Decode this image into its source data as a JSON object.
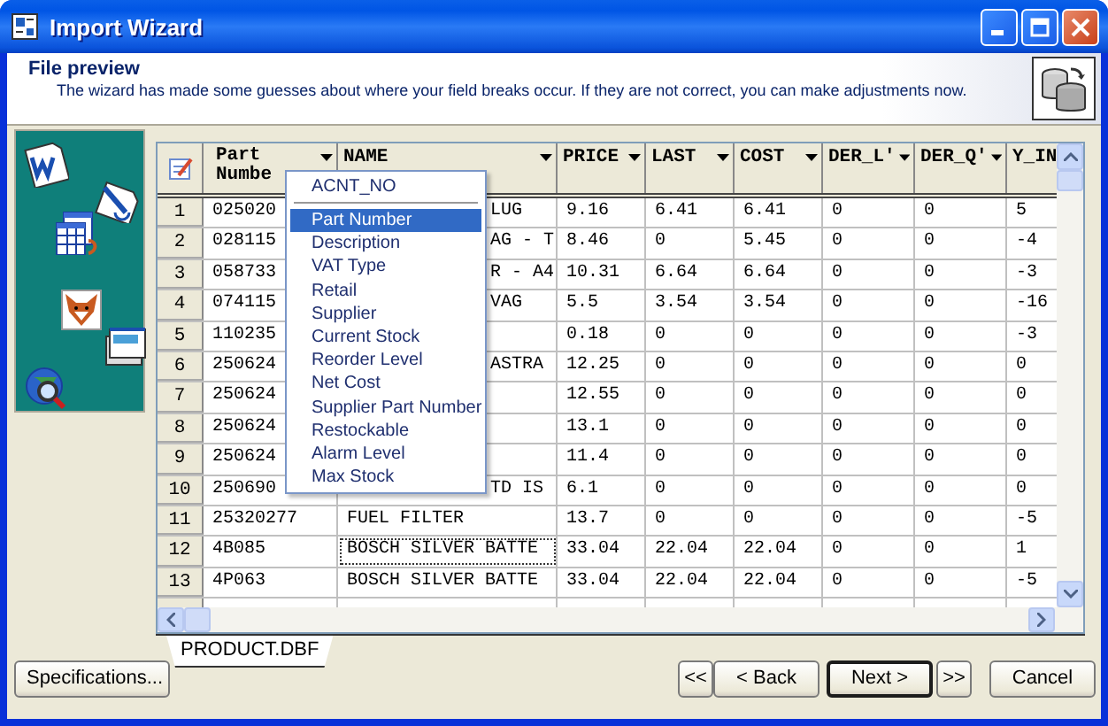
{
  "window": {
    "title": "Import Wizard"
  },
  "header": {
    "title": "File preview",
    "description": "The wizard has made some guesses about where your field breaks occur. If they are not correct, you can make adjustments now."
  },
  "table": {
    "columns": [
      "Part Numbe",
      "NAME",
      "PRICE",
      "LAST",
      "COST",
      "DER_L'",
      "DER_Q'",
      "Y_IN"
    ],
    "rows": [
      {
        "number": "1",
        "focused": false,
        "cells": [
          "025020",
          "LUG",
          "9.16",
          "6.41",
          "6.41",
          "0",
          "0",
          "5"
        ]
      },
      {
        "number": "2",
        "focused": false,
        "cells": [
          "028115",
          "AG - T",
          "8.46",
          "0",
          "5.45",
          "0",
          "0",
          "-4"
        ]
      },
      {
        "number": "3",
        "focused": false,
        "cells": [
          "058733",
          "R - A4",
          "10.31",
          "6.64",
          "6.64",
          "0",
          "0",
          "-3"
        ]
      },
      {
        "number": "4",
        "focused": false,
        "cells": [
          "074115",
          "VAG",
          "5.5",
          "3.54",
          "3.54",
          "0",
          "0",
          "-16"
        ]
      },
      {
        "number": "5",
        "focused": false,
        "cells": [
          "110235",
          "",
          "0.18",
          "0",
          "0",
          "0",
          "0",
          "-3"
        ]
      },
      {
        "number": "6",
        "focused": false,
        "cells": [
          "250624",
          "ASTRA",
          "12.25",
          "0",
          "0",
          "0",
          "0",
          "0"
        ]
      },
      {
        "number": "7",
        "focused": false,
        "cells": [
          "250624",
          "",
          "12.55",
          "0",
          "0",
          "0",
          "0",
          "0"
        ]
      },
      {
        "number": "8",
        "focused": false,
        "cells": [
          "250624",
          "",
          "13.1",
          "0",
          "0",
          "0",
          "0",
          "0"
        ]
      },
      {
        "number": "9",
        "focused": false,
        "cells": [
          "250624",
          "",
          "11.4",
          "0",
          "0",
          "0",
          "0",
          "0"
        ]
      },
      {
        "number": "10",
        "focused": false,
        "cells": [
          "250690",
          "TD IS",
          "6.1",
          "0",
          "0",
          "0",
          "0",
          "0"
        ]
      },
      {
        "number": "11",
        "focused": false,
        "cells": [
          "25320277",
          "FUEL FILTER",
          "13.7",
          "0",
          "0",
          "0",
          "0",
          "-5"
        ]
      },
      {
        "number": "12",
        "focused": true,
        "cells": [
          "4B085",
          "BOSCH SILVER BATTE",
          "33.04",
          "22.04",
          "22.04",
          "0",
          "0",
          "1"
        ]
      },
      {
        "number": "13",
        "focused": false,
        "cells": [
          "4P063",
          "BOSCH SILVER BATTE",
          "33.04",
          "22.04",
          "22.04",
          "0",
          "0",
          "-5"
        ]
      }
    ]
  },
  "column_menu": {
    "header": "ACNT_NO",
    "items": [
      {
        "label": "Part Number",
        "selected": true
      },
      {
        "label": "Description",
        "selected": false
      },
      {
        "label": "VAT Type",
        "selected": false
      },
      {
        "label": "Retail",
        "selected": false
      },
      {
        "label": "Supplier",
        "selected": false
      },
      {
        "label": "Current Stock",
        "selected": false
      },
      {
        "label": "Reorder Level",
        "selected": false
      },
      {
        "label": "Net Cost",
        "selected": false
      },
      {
        "label": "Supplier Part Number",
        "selected": false
      },
      {
        "label": "Restockable",
        "selected": false
      },
      {
        "label": "Alarm Level",
        "selected": false
      },
      {
        "label": "Max Stock",
        "selected": false
      }
    ]
  },
  "sheet_tabs": [
    {
      "label": "PRODUCT.DBF",
      "selected": true
    }
  ],
  "specifications_button": {
    "label": "Specifications...",
    "default": false
  },
  "nav_buttons": [
    {
      "label": "<<",
      "default": false
    },
    {
      "label": "< Back",
      "default": false
    },
    {
      "label": "Next >",
      "default": true
    },
    {
      "label": ">>",
      "default": false
    },
    {
      "label": "Cancel",
      "default": false
    }
  ]
}
